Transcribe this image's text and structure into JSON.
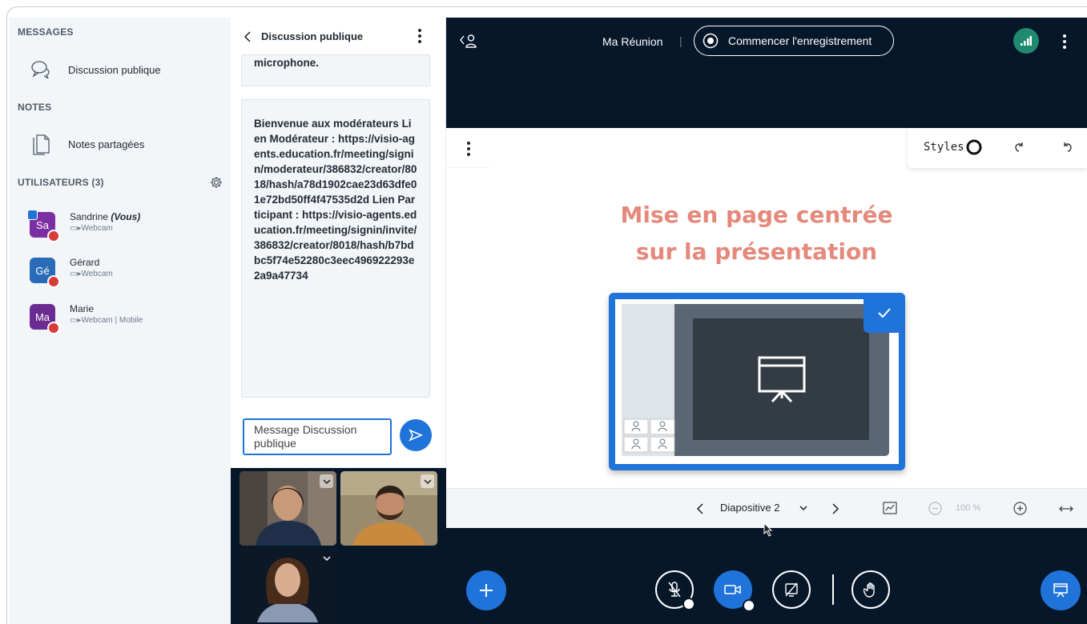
{
  "sidebar": {
    "messages_title": "MESSAGES",
    "public_chat": "Discussion publique",
    "notes_title": "NOTES",
    "shared_notes": "Notes partagées",
    "users_title": "UTILISATEURS (3)",
    "users": [
      {
        "initials": "Sa",
        "name": "Sandrine ",
        "you": "(Vous)",
        "status": "Webcam",
        "color": "#7c2fa3"
      },
      {
        "initials": "Gé",
        "name": "Gérard",
        "you": "",
        "status": "Webcam",
        "color": "#2a6bb8"
      },
      {
        "initials": "Ma",
        "name": "Marie",
        "you": "",
        "status": "Webcam | Mobile",
        "color": "#6b2c91"
      }
    ]
  },
  "chat": {
    "title": "Discussion publique",
    "truncated_message": "microphone.",
    "welcome_message": "Bienvenue aux modérateurs Lien Modérateur : https://visio-agents.education.fr/meeting/signin/moderateur/386832/creator/8018/hash/a78d1902cae23d63dfe01e72bd50ff4f47535d2d Lien Participant : https://visio-agents.education.fr/meeting/signin/invite/386832/creator/8018/hash/b7bdbc5f74e52280c3eec496922293e2a9a47734",
    "input_placeholder": "Message Discussion publique"
  },
  "topbar": {
    "meeting_name": "Ma Réunion",
    "separator": "|",
    "record_label": "Commencer l'enregistrement"
  },
  "presentation": {
    "styles_label": "Styles",
    "slide_title_line1": "Mise en page centrée",
    "slide_title_line2": "sur la présentation",
    "slide_label": "Diapositive 2",
    "zoom": "100 %"
  },
  "colors": {
    "accent": "#2074d9",
    "dark_bg": "#06172a",
    "slide_title": "#e4897b",
    "mic_muted": "#d93a3a",
    "connection_good": "#1f8a70"
  },
  "icons": {
    "chat": "chat-bubbles-icon",
    "notes": "document-icon",
    "settings": "gear-icon",
    "back": "chevron-left-icon",
    "more": "kebab-menu-icon",
    "record": "record-circle-icon",
    "connection": "signal-bars-icon",
    "send": "send-icon",
    "add": "plus-icon",
    "mic": "microphone-muted-icon",
    "camera": "camera-icon",
    "screenshare": "screen-share-off-icon",
    "raise_hand": "hand-icon",
    "presentation": "presentation-icon"
  }
}
